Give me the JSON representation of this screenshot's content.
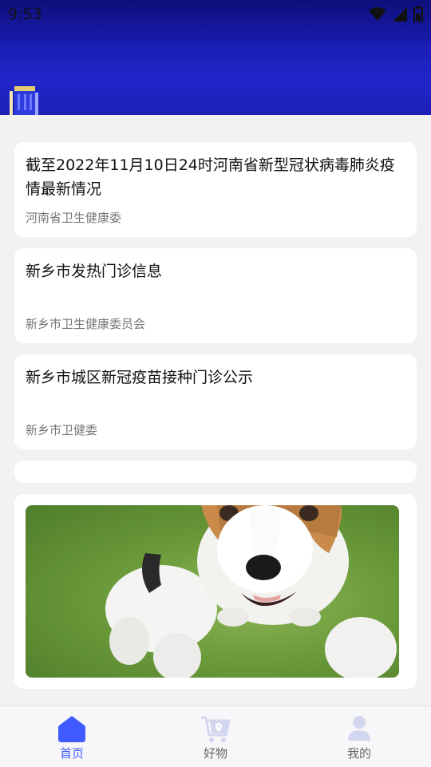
{
  "status": {
    "time": "9:53"
  },
  "news": [
    {
      "title": "截至2022年11月10日24时河南省新型冠状病毒肺炎疫情最新情况",
      "source": "河南省卫生健康委"
    },
    {
      "title": "新乡市发热门诊信息",
      "source": "新乡市卫生健康委员会"
    },
    {
      "title": "新乡市城区新冠疫苗接种门诊公示",
      "source": "新乡市卫健委"
    }
  ],
  "tabs": [
    {
      "label": "首页",
      "icon": "home-icon",
      "active": true
    },
    {
      "label": "好物",
      "icon": "cart-location-icon",
      "active": false
    },
    {
      "label": "我的",
      "icon": "user-icon",
      "active": false
    }
  ],
  "colors": {
    "accent": "#3f5bff",
    "header": "#1b1fb8",
    "inactive_icon": "#d3d6ef"
  }
}
